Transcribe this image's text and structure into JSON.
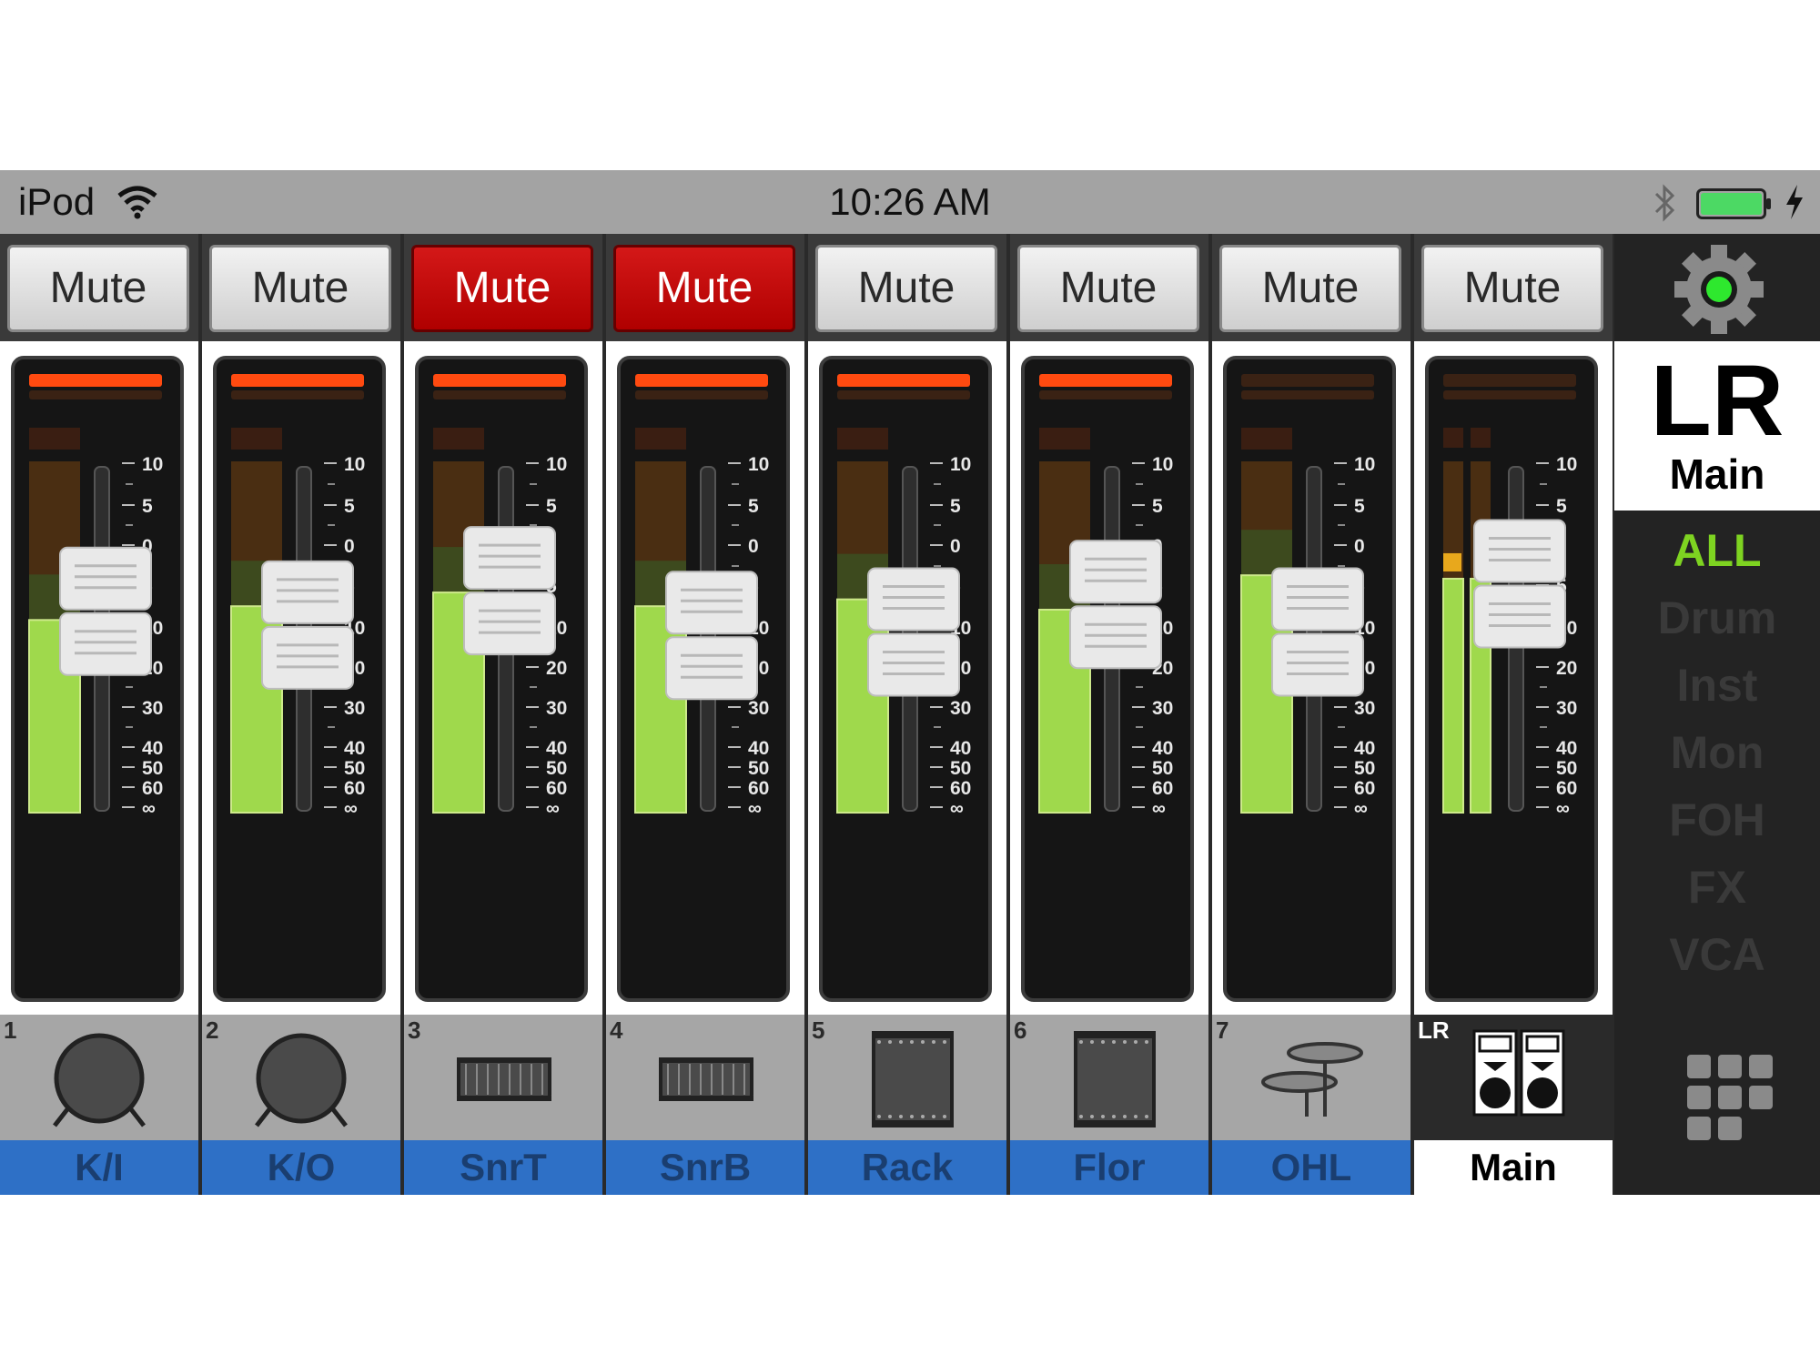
{
  "status_bar": {
    "carrier": "iPod",
    "time": "10:26 AM"
  },
  "channels": [
    {
      "number": "1",
      "name": "K/I",
      "mute": "Mute",
      "muted": false,
      "icon": "kick-drum-icon",
      "fader": 0.58,
      "meter": 0.56,
      "peak": true
    },
    {
      "number": "2",
      "name": "K/O",
      "mute": "Mute",
      "muted": false,
      "icon": "kick-drum-icon",
      "fader": 0.54,
      "meter": 0.6,
      "peak": true
    },
    {
      "number": "3",
      "name": "SnrT",
      "mute": "Mute",
      "muted": true,
      "icon": "snare-drum-icon",
      "fader": 0.64,
      "meter": 0.64,
      "peak": true
    },
    {
      "number": "4",
      "name": "SnrB",
      "mute": "Mute",
      "muted": true,
      "icon": "snare-drum-icon",
      "fader": 0.51,
      "meter": 0.6,
      "peak": true
    },
    {
      "number": "5",
      "name": "Rack",
      "mute": "Mute",
      "muted": false,
      "icon": "tom-drum-icon",
      "fader": 0.52,
      "meter": 0.62,
      "peak": true
    },
    {
      "number": "6",
      "name": "Flor",
      "mute": "Mute",
      "muted": false,
      "icon": "tom-drum-icon",
      "fader": 0.6,
      "meter": 0.59,
      "peak": true
    },
    {
      "number": "7",
      "name": "OHL",
      "mute": "Mute",
      "muted": false,
      "icon": "cymbal-icon",
      "fader": 0.52,
      "meter": 0.69,
      "peak": false
    }
  ],
  "main": {
    "number": "LR",
    "name": "Main",
    "mute": "Mute",
    "muted": false,
    "icon": "speakers-icon",
    "fader": 0.66,
    "meter": 0.68,
    "peak": false
  },
  "scale_labels": [
    "10",
    "5",
    "0",
    "5",
    "10",
    "20",
    "30",
    "40",
    "50",
    "60",
    "∞"
  ],
  "sidebar": {
    "selected_big": "LR",
    "selected_small": "Main",
    "groups": [
      "ALL",
      "Drum",
      "Inst",
      "Mon",
      "FOH",
      "FX",
      "VCA"
    ],
    "active_group": "ALL"
  },
  "colors": {
    "mute_on": "#c80000",
    "meter_green": "#9fd94c",
    "label_blue": "#2e70c6",
    "active_group": "#7ed321"
  }
}
